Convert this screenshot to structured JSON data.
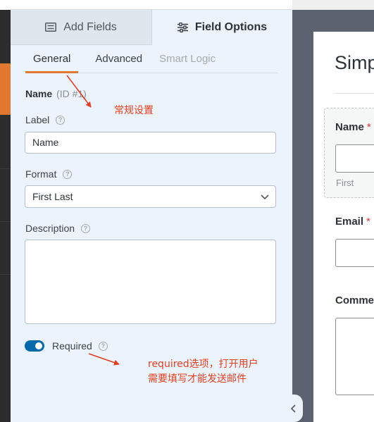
{
  "tabs": {
    "add_fields": "Add Fields",
    "field_options": "Field Options"
  },
  "subtabs": {
    "general": "General",
    "advanced": "Advanced",
    "smart_logic": "Smart Logic"
  },
  "field": {
    "name": "Name",
    "id_text": "(ID #1)"
  },
  "label": {
    "title": "Label",
    "value": "Name"
  },
  "format": {
    "title": "Format",
    "selected": "First Last"
  },
  "description": {
    "title": "Description",
    "value": ""
  },
  "required": {
    "label": "Required",
    "enabled": true
  },
  "annotations": {
    "general_note": "常规设置",
    "required_note_line1": "required选项，打开用户",
    "required_note_line2": "需要填写才能发送邮件"
  },
  "preview": {
    "form_title": "Simp",
    "name_label": "Name",
    "name_required": "*",
    "name_sublabel": "First",
    "email_label": "Email",
    "email_required": "*",
    "comment_label": "Comme"
  },
  "colors": {
    "accent_orange": "#e27730",
    "toggle_blue": "#056aab",
    "annotation_red": "#e53e1e",
    "panel_bg": "#ebf3fc"
  },
  "icons": {
    "add_fields": "list-icon",
    "field_options": "sliders-icon",
    "help": "question-circle-icon",
    "select": "chevron-down-icon",
    "collapse": "chevron-left-icon"
  }
}
